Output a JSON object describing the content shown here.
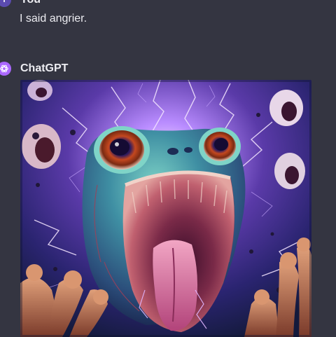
{
  "user_message": {
    "author": "You",
    "avatar_initial": "Y",
    "text": "I said angrier."
  },
  "assistant_message": {
    "author": "ChatGPT",
    "avatar_icon": "openai-logo-icon",
    "image_subject": "generated-image"
  },
  "colors": {
    "background": "#343541",
    "text": "#ececf1",
    "assistant_avatar": "#ab68ff"
  }
}
